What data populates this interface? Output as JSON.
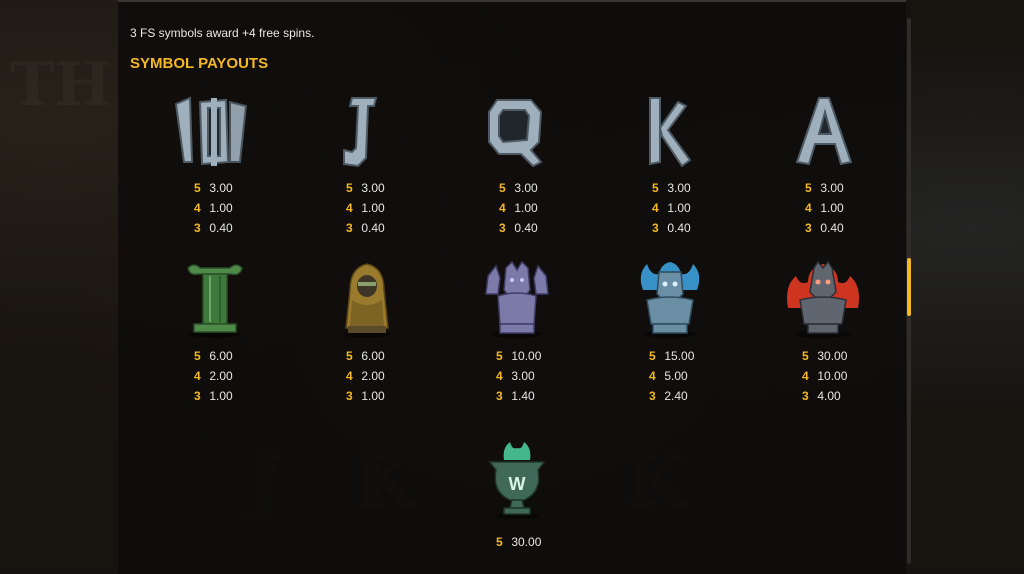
{
  "intro_text": "3 FS symbols award +4 free spins.",
  "section_title": "SYMBOL PAYOUTS",
  "colors": {
    "accent": "#f4b824",
    "text": "#e6e6e6"
  },
  "symbols": [
    {
      "name": "10",
      "icon": "ten-icon",
      "payouts": [
        {
          "count": "5",
          "value": "3.00"
        },
        {
          "count": "4",
          "value": "1.00"
        },
        {
          "count": "3",
          "value": "0.40"
        }
      ]
    },
    {
      "name": "J",
      "icon": "jack-icon",
      "payouts": [
        {
          "count": "5",
          "value": "3.00"
        },
        {
          "count": "4",
          "value": "1.00"
        },
        {
          "count": "3",
          "value": "0.40"
        }
      ]
    },
    {
      "name": "Q",
      "icon": "queen-icon",
      "payouts": [
        {
          "count": "5",
          "value": "3.00"
        },
        {
          "count": "4",
          "value": "1.00"
        },
        {
          "count": "3",
          "value": "0.40"
        }
      ]
    },
    {
      "name": "K",
      "icon": "king-icon",
      "payouts": [
        {
          "count": "5",
          "value": "3.00"
        },
        {
          "count": "4",
          "value": "1.00"
        },
        {
          "count": "3",
          "value": "0.40"
        }
      ]
    },
    {
      "name": "A",
      "icon": "ace-icon",
      "payouts": [
        {
          "count": "5",
          "value": "3.00"
        },
        {
          "count": "4",
          "value": "1.00"
        },
        {
          "count": "3",
          "value": "0.40"
        }
      ]
    },
    {
      "name": "column",
      "icon": "green-column-icon",
      "payouts": [
        {
          "count": "5",
          "value": "6.00"
        },
        {
          "count": "4",
          "value": "2.00"
        },
        {
          "count": "3",
          "value": "1.00"
        }
      ]
    },
    {
      "name": "hooded",
      "icon": "hooded-figure-icon",
      "payouts": [
        {
          "count": "5",
          "value": "6.00"
        },
        {
          "count": "4",
          "value": "2.00"
        },
        {
          "count": "3",
          "value": "1.00"
        }
      ]
    },
    {
      "name": "cerberus",
      "icon": "cerberus-icon",
      "payouts": [
        {
          "count": "5",
          "value": "10.00"
        },
        {
          "count": "4",
          "value": "3.00"
        },
        {
          "count": "3",
          "value": "1.40"
        }
      ]
    },
    {
      "name": "blue-god",
      "icon": "blue-flame-god-icon",
      "payouts": [
        {
          "count": "5",
          "value": "15.00"
        },
        {
          "count": "4",
          "value": "5.00"
        },
        {
          "count": "3",
          "value": "2.40"
        }
      ]
    },
    {
      "name": "red-god",
      "icon": "red-flame-god-icon",
      "payouts": [
        {
          "count": "5",
          "value": "30.00"
        },
        {
          "count": "4",
          "value": "10.00"
        },
        {
          "count": "3",
          "value": "4.00"
        }
      ]
    },
    {
      "name": "wild",
      "icon": "wild-urn-icon",
      "payouts": [
        {
          "count": "5",
          "value": "30.00"
        }
      ]
    }
  ]
}
